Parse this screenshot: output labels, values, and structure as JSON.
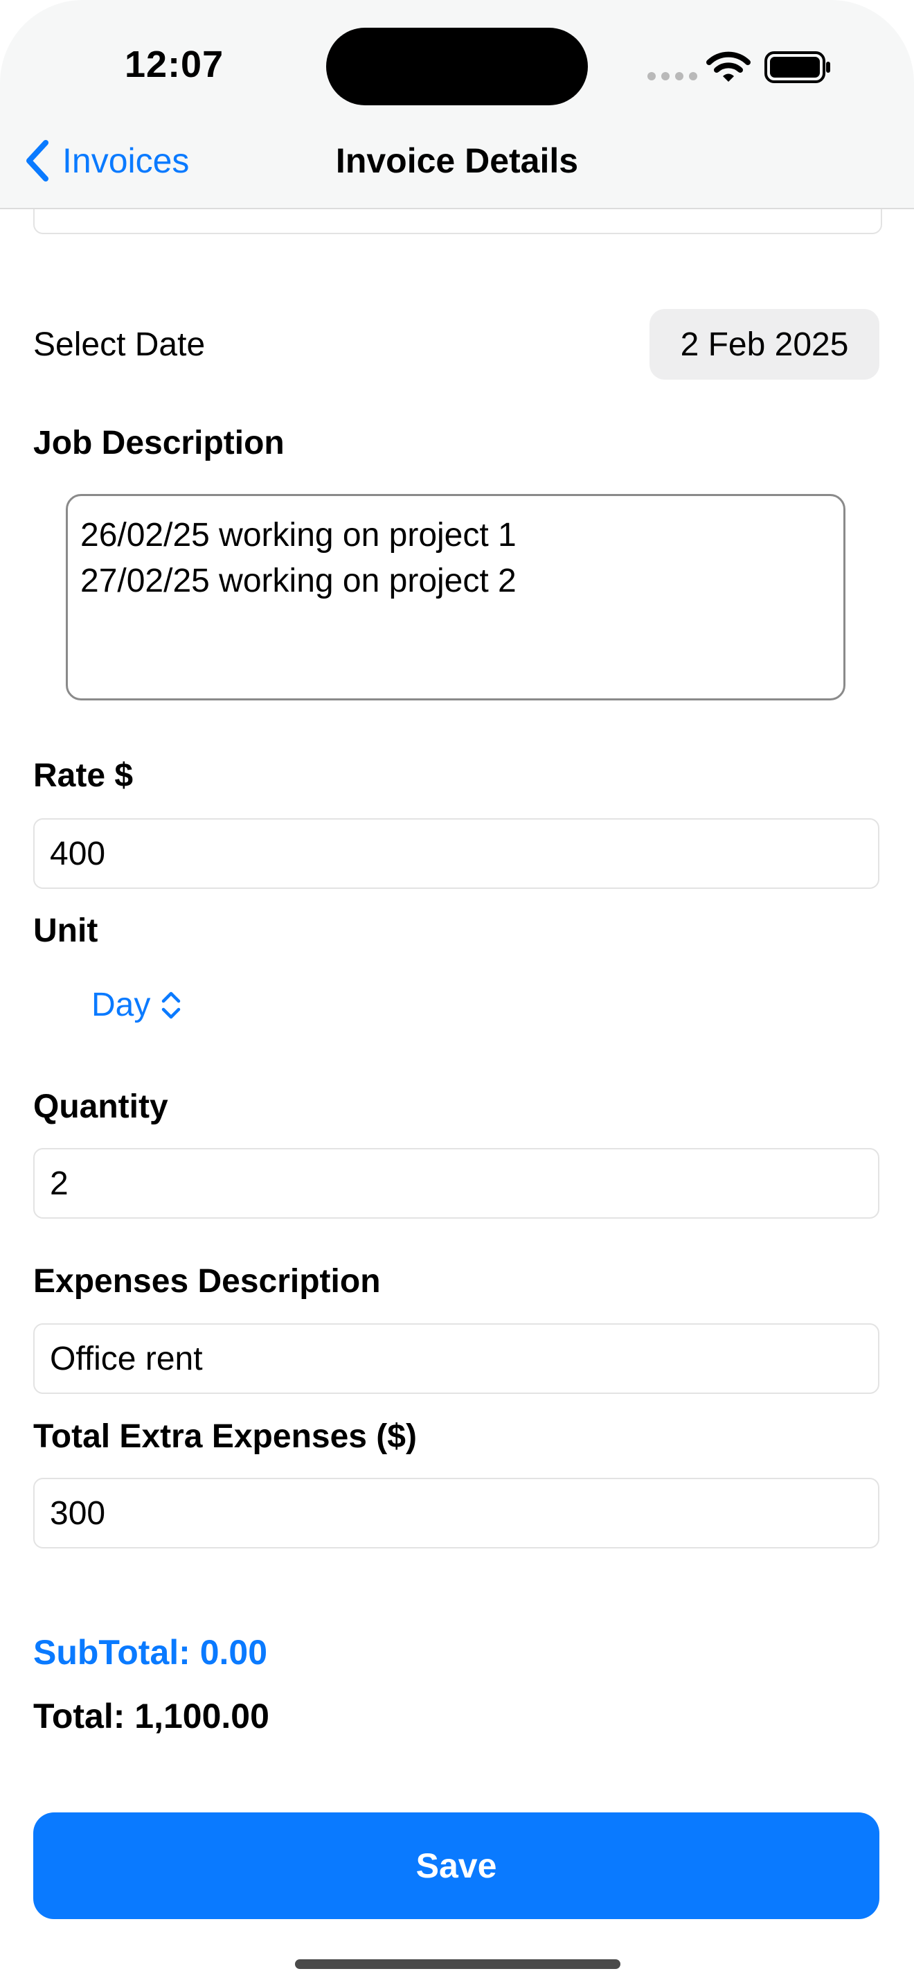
{
  "status_bar": {
    "time": "12:07"
  },
  "nav": {
    "back_label": "Invoices",
    "title": "Invoice Details"
  },
  "form": {
    "date": {
      "label": "Select Date",
      "value": "2 Feb 2025"
    },
    "job_description": {
      "label": "Job Description",
      "value": "26/02/25 working on project 1\n27/02/25 working on project 2"
    },
    "rate": {
      "label": "Rate $",
      "value": "400"
    },
    "unit": {
      "label": "Unit",
      "value": "Day"
    },
    "quantity": {
      "label": "Quantity",
      "value": "2"
    },
    "expenses_description": {
      "label": "Expenses Description",
      "value": "Office rent"
    },
    "extra_expenses": {
      "label": "Total Extra Expenses ($)",
      "value": "300"
    }
  },
  "summary": {
    "subtotal": "SubTotal: 0.00",
    "total": "Total: 1,100.00"
  },
  "actions": {
    "save_label": "Save"
  },
  "colors": {
    "accent": "#0a7aff",
    "background": "#ffffff",
    "header_background": "#f6f7f7"
  }
}
